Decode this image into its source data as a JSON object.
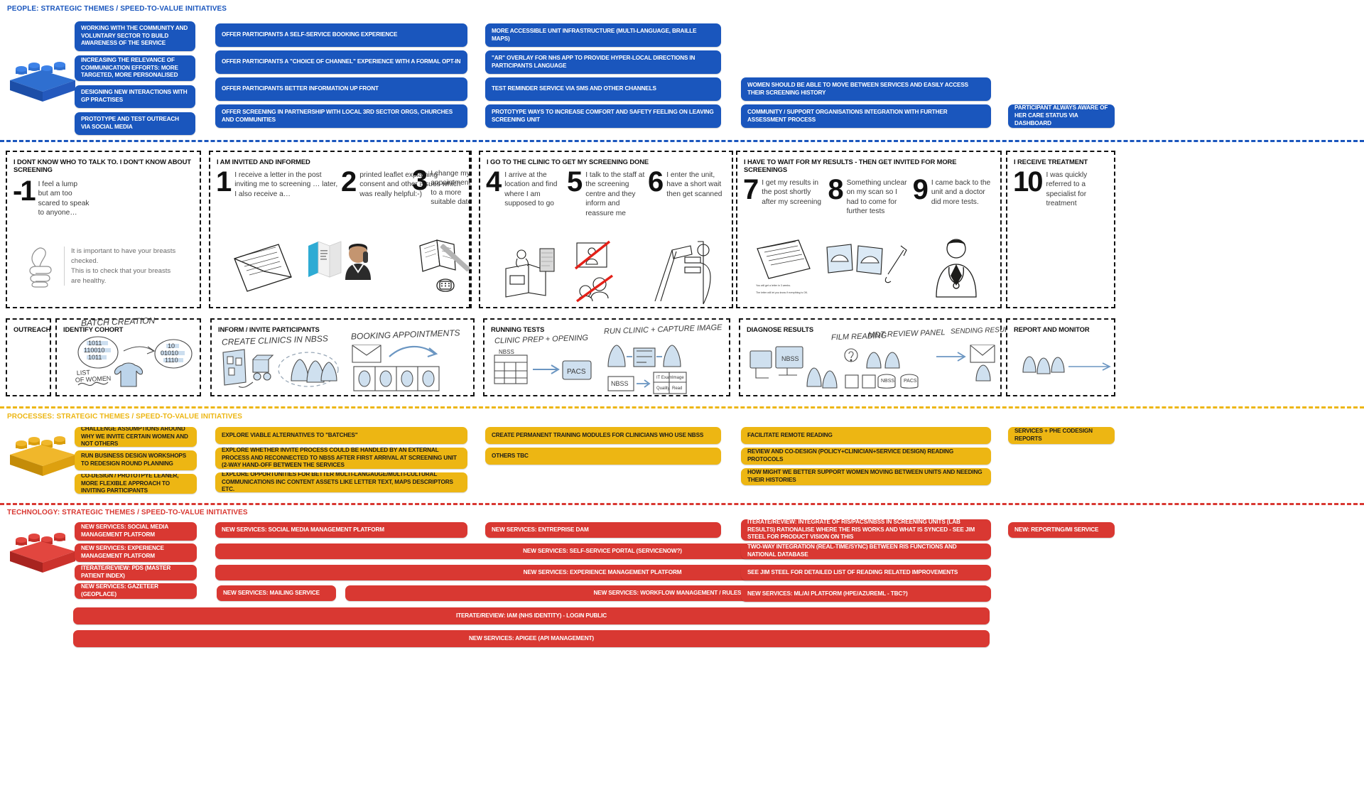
{
  "sections": {
    "people": {
      "title": "PEOPLE: STRATEGIC THEMES / SPEED-TO-VALUE INITIATIVES",
      "color": "#1a56bd",
      "brick_icon": "blue-lego-brick",
      "col1": [
        "WORKING WITH THE COMMUNITY AND VOLUNTARY SECTOR TO BUILD AWARENESS OF THE SERVICE",
        "INCREASING THE RELEVANCE OF COMMUNICATION EFFORTS: MORE TARGETED, MORE PERSONALISED",
        "DESIGNING NEW INTERACTIONS WITH GP PRACTISES",
        "PROTOTYPE AND TEST OUTREACH VIA SOCIAL MEDIA"
      ],
      "col2": [
        "OFFER PARTICIPANTS A SELF-SERVICE BOOKING EXPERIENCE",
        "OFFER PARTICIPANTS A \"CHOICE OF CHANNEL\" EXPERIENCE WITH A FORMAL OPT-IN",
        "OFFER PARTICIPANTS BETTER INFORMATION UP FRONT",
        "OFFER SCREENING IN PARTNERSHIP WITH LOCAL 3RD SECTOR ORGS, CHURCHES AND COMMUNITIES"
      ],
      "col3": [
        "MORE ACCESSIBLE UNIT INFRASTRUCTURE (MULTI-LANGUAGE, BRAILLE MAPS)",
        "\"AR\" OVERLAY FOR NHS APP TO PROVIDE HYPER-LOCAL DIRECTIONS IN PARTICIPANTS LANGUAGE",
        "TEST REMINDER SERVICE VIA SMS AND OTHER CHANNELS",
        "PROTOTYPE WAYS TO INCREASE COMFORT AND SAFETY FEELING ON LEAVING SCREENING UNIT"
      ],
      "col4": [
        "WOMEN SHOULD BE ABLE TO MOVE BETWEEN SERVICES AND EASILY ACCESS THEIR SCREENING HISTORY",
        "COMMUNITY / SUPPORT ORGANISATIONS INTEGRATION WITH FURTHER ASSESSMENT PROCESS"
      ],
      "col5": [
        "PARTICIPANT ALWAYS AWARE OF HER CARE STATUS VIA DASHBOARD"
      ]
    },
    "processes": {
      "title": "PROCESSES: STRATEGIC THEMES / SPEED-TO-VALUE INITIATIVES",
      "color": "#edb613",
      "brick_icon": "yellow-lego-brick",
      "col1": [
        "CHALLENGE ASSUMPTIONS AROUND WHY WE INVITE CERTAIN WOMEN AND NOT OTHERS",
        "RUN BUSINESS DESIGN WORKSHOPS TO REDESIGN ROUND PLANNING",
        "CO-DESIGN / PROTOTPYE LEANER, MORE FLEXIBLE APPROACH TO  INVITING PARTICIPANTS"
      ],
      "col2": [
        "EXPLORE VIABLE ALTERNATIVES TO \"BATCHES\"",
        "EXPLORE WHETHER INVITE PROCESS COULD BE HANDLED BY AN EXTERNAL PROCESS AND RECONNECTED TO NBSS AFTER FIRST ARRIVAL AT SCREENING UNIT (2-WAY HAND-OFF BETWEEN THE SERVICES",
        "EXPLORE OPPORTUNITIES FOR BETTER MULTI-LANGAUGE/MULTI-CULTURAL COMMUNICATIONS INC CONTENT ASSETS LIKE LETTER TEXT, MAPS DESCRIPTORS ETC."
      ],
      "col3": [
        "CREATE PERMANENT TRAINING MODULES FOR CLINICIANS WHO USE NBSS",
        "OTHERS TBC"
      ],
      "col4": [
        "FACILITATE REMOTE READING",
        "REVIEW AND CO-DESIGN (POLICY+CLINICIAN+SERVICE DESIGN) READING PROTOCOLS",
        "HOW MIGHT WE BETTER SUPPORT WOMEN MOVING BETWEEN UNITS AND NEEDING THEIR HISTORIES"
      ],
      "col5": [
        "SERVICES + PHE CODESIGN REPORTS"
      ]
    },
    "technology": {
      "title": "TECHNOLOGY: STRATEGIC THEMES / SPEED-TO-VALUE INITIATIVES",
      "color": "#d93832",
      "brick_icon": "red-lego-brick",
      "col1": [
        "NEW SERVICES: SOCIAL MEDIA MANAGEMENT PLATFORM",
        "NEW SERVICES: EXPERIENCE MANAGEMENT PLATFORM",
        "ITERATE/REVIEW: PDS (MASTER PATIENT INDEX)",
        "NEW SERVICES: GAZETEER (GEOPLACE)"
      ],
      "col2": [
        "NEW SERVICES: SOCIAL MEDIA MANAGEMENT PLATFORM",
        "NEW SERVICES: SELF-SERVICE PORTAL (SERVICENOW?)",
        "NEW SERVICES: EXPERIENCE MANAGEMENT PLATFORM",
        "NEW SERVICES: MAILING SERVICE",
        "NEW SERVICES: WORKFLOW MANAGEMENT / RULES"
      ],
      "col3": [
        "NEW SERVICES: ENTREPRISE DAM"
      ],
      "col4": [
        "ITERATE/REVIEW:  INTEGRATE OF RIS/PACS/NBSS IN SCREENING UNITS (LAB RESULTS) RATIONALISE WHERE THE RIS WORKS AND WHAT IS SYNCED - SEE JIM STEEL FOR PRODUCT VISION ON THIS",
        "TWO-WAY INTEGRATION (REAL-TIME/SYNC) BETWEEN RIS FUNCTIONS AND NATIONAL DATABASE",
        "SEE JIM STEEL FOR DETAILED LIST OF READING RELATED IMPROVEMENTS",
        "NEW SERVICES: ML/AI PLATFORM (HPE/AzureML - TBC?)"
      ],
      "col5": [
        "NEW: REPORTING/MI SERVICE"
      ],
      "full_width": [
        "ITERATE/REVIEW: IAM (NHS IDENTITY) - LOGIN PUBLIC",
        "NEW SERVICES: APIGEE (API MANAGEMENT)"
      ]
    }
  },
  "journey": {
    "stages": [
      {
        "title": "I DONT KNOW WHO TO TALK TO. I DON'T KNOW ABOUT SCREENING",
        "steps": [
          {
            "num": "-1",
            "text": "I feel a lump but am too scared to speak to anyone…"
          }
        ],
        "quote": "It is important to have your breasts checked.\nThis is to check that your breasts are healthy.",
        "quote_icon": "thumbs-up-sketch"
      },
      {
        "title": "I AM INVITED AND INFORMED",
        "steps": [
          {
            "num": "1",
            "text": "I receive a letter in the post inviting me to screening … later, I also receive a…"
          },
          {
            "num": "2",
            "text": "printed leaflet explaining consent and other issues which was really helpful:-)"
          },
          {
            "num": "3",
            "text": "I change my appointment to a more suitable date"
          }
        ]
      },
      {
        "title": "I GO TO THE CLINIC TO GET MY SCREENING DONE",
        "steps": [
          {
            "num": "4",
            "text": "I arrive at the location and find where I am supposed to go"
          },
          {
            "num": "5",
            "text": "I talk to the staff at the screening centre and they inform and reassure me"
          },
          {
            "num": "6",
            "text": "I enter the unit, have a short wait then get scanned"
          }
        ]
      },
      {
        "title": "I HAVE TO WAIT FOR MY RESULTS - THEN GET INVITED FOR MORE SCREENINGS",
        "steps": [
          {
            "num": "7",
            "text": "I get my results in the post shortly after my screening"
          },
          {
            "num": "8",
            "text": "Something unclear on my scan so I had to come for further tests"
          },
          {
            "num": "9",
            "text": "I came back to the unit and a doctor did more tests."
          }
        ]
      },
      {
        "title": "I RECEIVE TREATMENT",
        "steps": [
          {
            "num": "10",
            "text": "I was quickly referred to a specialist for treatment"
          }
        ]
      }
    ],
    "letter_caption_line1": "You will get a letter in 3 weeks.",
    "letter_caption_line2": "The letter will let you know if everything is OK."
  },
  "backstage": {
    "boxes": [
      {
        "title": "OUTREACH",
        "sketch_label": ""
      },
      {
        "title": "IDENTIFY COHORT",
        "sketch_label": "BATCH CREATION",
        "sub_labels": [
          "LIST OF WOMEN",
          "1011 110010 1011",
          "10 01010 1110"
        ]
      },
      {
        "title": "INFORM / INVITE PARTICIPANTS",
        "sketch_label": "CREATE CLINICS IN NBSS",
        "sketch_label2": "BOOKING APPOINTMENTS"
      },
      {
        "title": "RUNNING TESTS",
        "sketch_label": "CLINIC PREP + OPENING",
        "sketch_label2": "RUN CLINIC + CAPTURE IMAGE",
        "sub_labels": [
          "NBSS",
          "PACS",
          "NBSS"
        ]
      },
      {
        "title": "DIAGNOSE RESULTS",
        "sketch_label": "FILM READING",
        "sketch_label2": "MDT REVIEW PANEL",
        "sketch_label3": "SENDING RESULTS",
        "sub_labels": [
          "NBSS",
          "NBSS",
          "PACS"
        ]
      },
      {
        "title": "REPORT AND MONITOR",
        "sketch_label": ""
      }
    ]
  }
}
